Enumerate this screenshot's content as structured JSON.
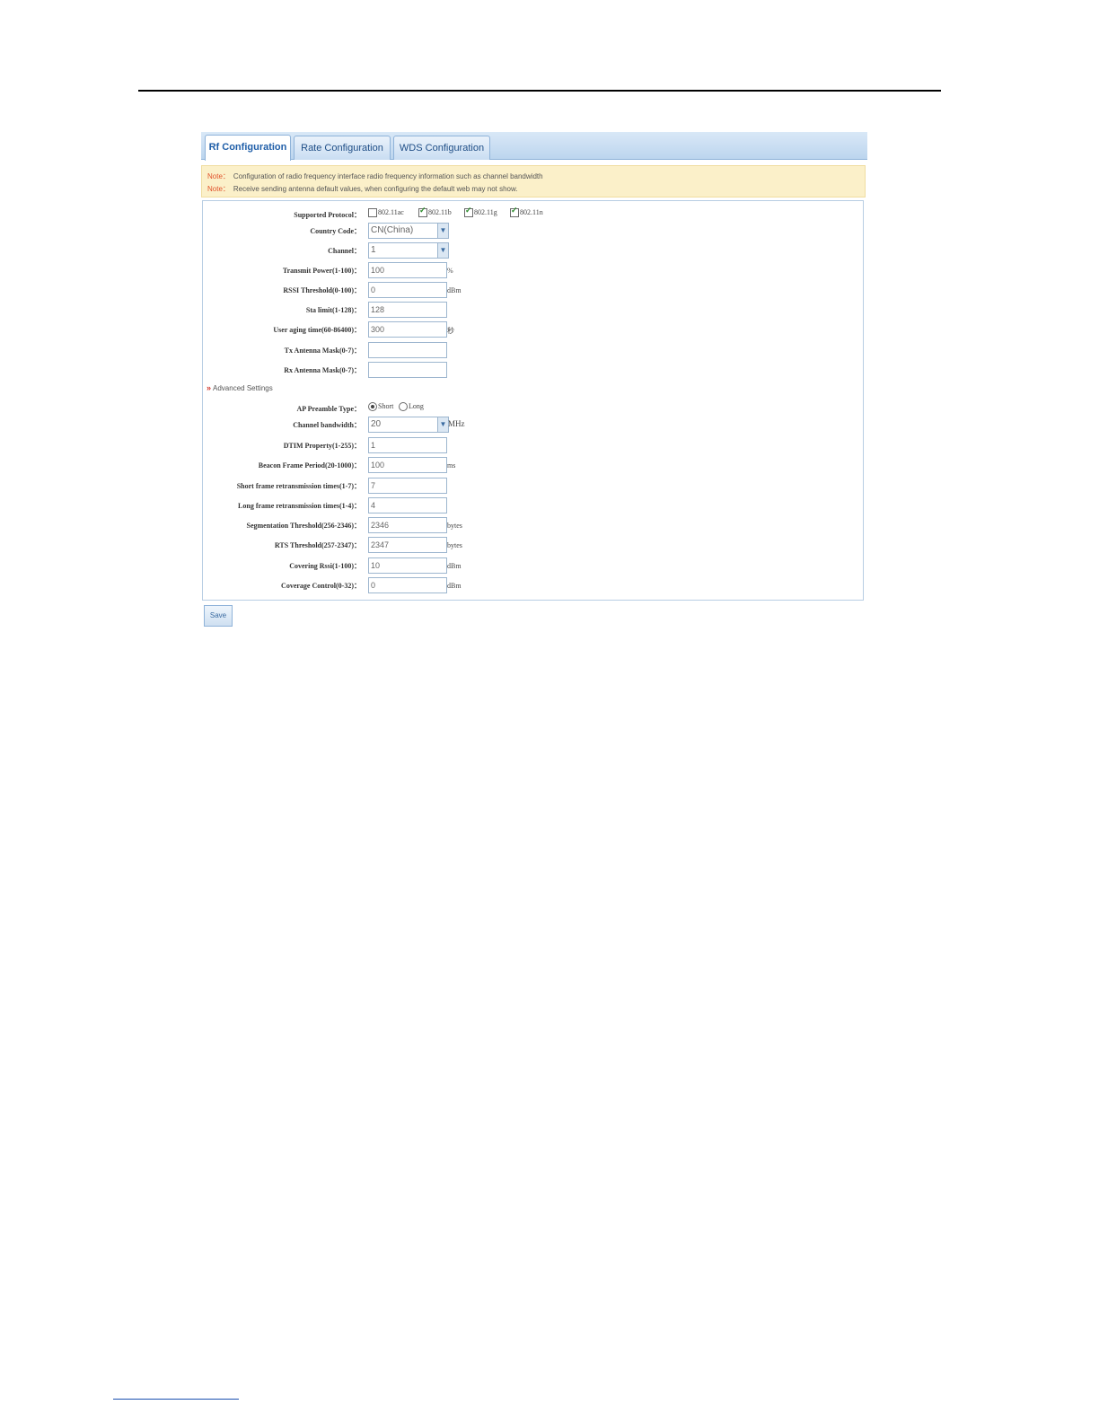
{
  "tabs": [
    "Rf Configuration",
    "Rate Configuration",
    "WDS Configuration"
  ],
  "notes": [
    {
      "tag": "Note：",
      "text": "Configuration of radio frequency interface radio frequency information such as channel bandwidth"
    },
    {
      "tag": "Note：",
      "text": "Receive sending antenna default values, when configuring the default web may not show."
    }
  ],
  "protocols": {
    "label": "Supported Protocol：",
    "options": [
      {
        "name": "802.11ac",
        "checked": false
      },
      {
        "name": "802.11b",
        "checked": true
      },
      {
        "name": "802.11g",
        "checked": true
      },
      {
        "name": "802.11n",
        "checked": true
      }
    ]
  },
  "country": {
    "label": "Country Code：",
    "value": "CN(China)"
  },
  "channel": {
    "label": "Channel：",
    "value": "1"
  },
  "transmit_power": {
    "label": "Transmit Power(1-100)：",
    "value": "100",
    "unit": "%"
  },
  "rssi": {
    "label": "RSSI Threshold(0-100)：",
    "value": "0",
    "unit": "dBm"
  },
  "sta_limit": {
    "label": "Sta limit(1-128)：",
    "value": "128"
  },
  "user_aging": {
    "label": "User aging time(60-86400)：",
    "value": "300",
    "unit": "秒"
  },
  "tx_mask": {
    "label": "Tx Antenna Mask(0-7)：",
    "value": ""
  },
  "rx_mask": {
    "label": "Rx Antenna Mask(0-7)：",
    "value": ""
  },
  "advanced": {
    "icon": "double-chevron-down-icon",
    "label": "Advanced Settings"
  },
  "preamble": {
    "label": "AP Preamble Type：",
    "options": [
      {
        "name": "Short",
        "selected": true
      },
      {
        "name": "Long",
        "selected": false
      }
    ]
  },
  "bandwidth": {
    "label": "Channel bandwidth：",
    "value": "20",
    "unit": "MHz"
  },
  "dtim": {
    "label": "DTIM Property(1-255)：",
    "value": "1"
  },
  "beacon": {
    "label": "Beacon Frame Period(20-1000)：",
    "value": "100",
    "unit": "ms"
  },
  "short_retry": {
    "label": "Short frame retransmission times(1-7)：",
    "value": "7"
  },
  "long_retry": {
    "label": "Long frame retransmission times(1-4)：",
    "value": "4"
  },
  "segmentation": {
    "label": "Segmentation Threshold(256-2346)：",
    "value": "2346",
    "unit": "bytes"
  },
  "rts": {
    "label": "RTS Threshold(257-2347)：",
    "value": "2347",
    "unit": "bytes"
  },
  "covering_rssi": {
    "label": "Covering Rssi(1-100)：",
    "value": "10",
    "unit": "dBm"
  },
  "coverage_control": {
    "label": "Coverage Control(0-32)：",
    "value": "0",
    "unit": "dBm"
  },
  "save_label": "Save",
  "colors": {
    "tab_text": "#1f4e86",
    "note_tag": "#e0522b",
    "note_bg": "#fbf0c9",
    "border": "#8fb3d9"
  }
}
